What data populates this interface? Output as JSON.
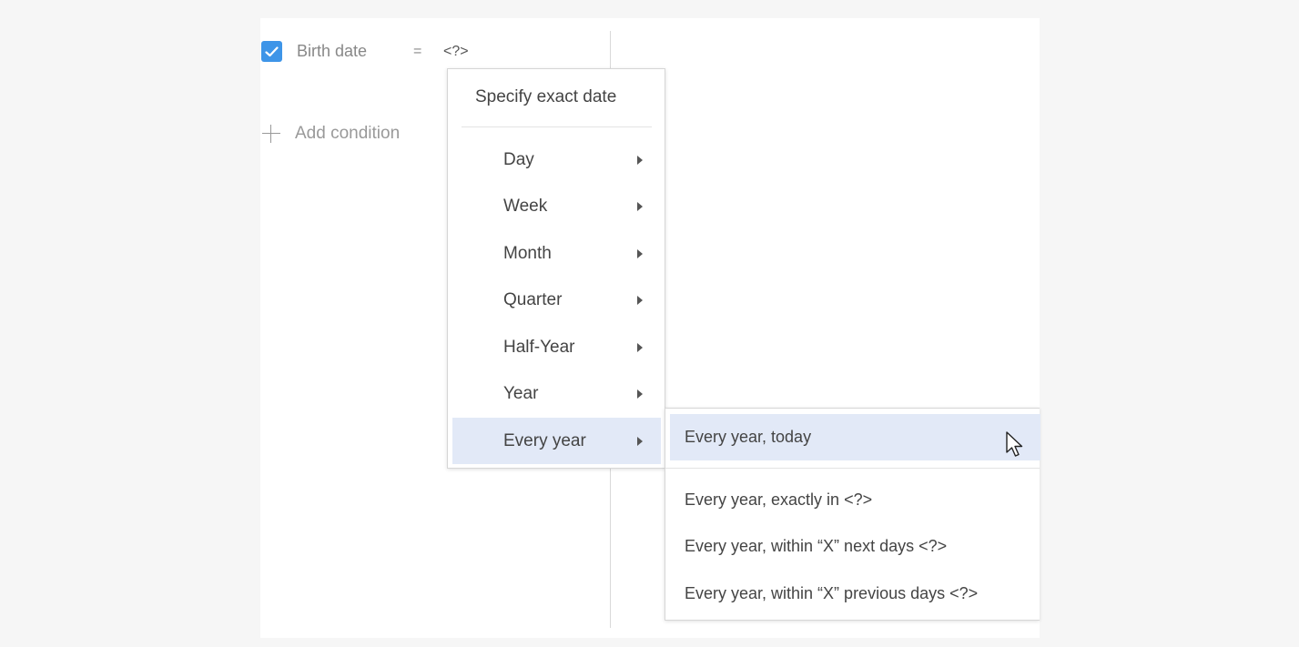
{
  "condition": {
    "checked": true,
    "field_label": "Birth date",
    "operator": "=",
    "value": "<?>"
  },
  "add_condition": {
    "label": "Add condition",
    "icon": "plus-icon"
  },
  "menu": {
    "header": "Specify exact date",
    "items": [
      {
        "label": "Day",
        "has_submenu": true
      },
      {
        "label": "Week",
        "has_submenu": true
      },
      {
        "label": "Month",
        "has_submenu": true
      },
      {
        "label": "Quarter",
        "has_submenu": true
      },
      {
        "label": "Half-Year",
        "has_submenu": true
      },
      {
        "label": "Year",
        "has_submenu": true
      },
      {
        "label": "Every year",
        "has_submenu": true,
        "active": true
      }
    ]
  },
  "submenu": {
    "items": [
      {
        "label": "Every year, today",
        "active": true
      },
      {
        "label": "Every year, exactly in <?>"
      },
      {
        "label": "Every year, within “X” next days <?>"
      },
      {
        "label": "Every year, within “X” previous days <?>"
      }
    ]
  },
  "colors": {
    "accent": "#3e95e8",
    "highlight": "#e2e9f7",
    "background": "#f6f6f6"
  }
}
